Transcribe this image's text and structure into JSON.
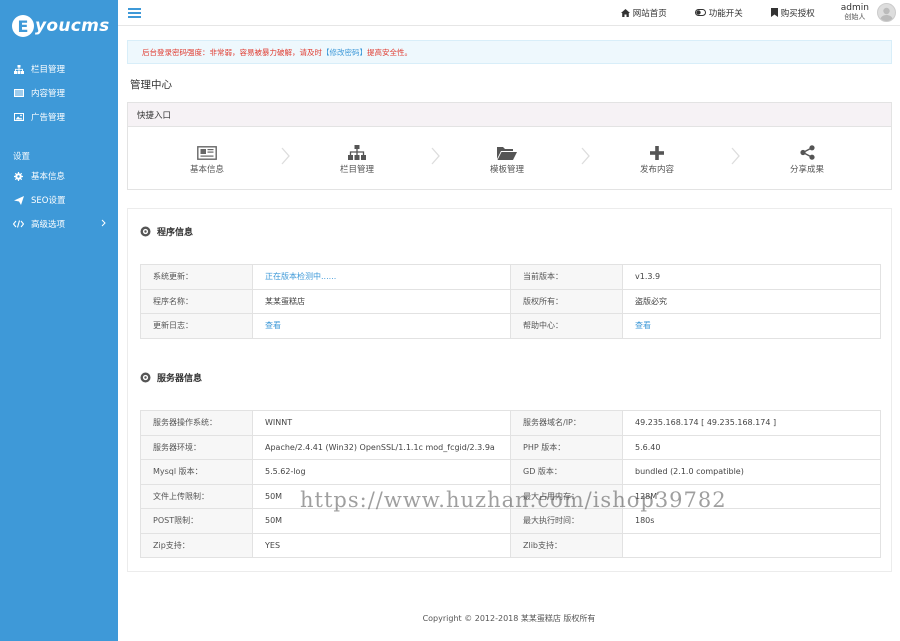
{
  "sidebar": {
    "logo_mark": "E",
    "logo_text": "youcms",
    "items": [
      {
        "label": "栏目管理",
        "icon": "sitemap-icon"
      },
      {
        "label": "内容管理",
        "icon": "list-icon"
      },
      {
        "label": "广告管理",
        "icon": "image-icon"
      }
    ],
    "section_label": "设置",
    "settings": [
      {
        "label": "基本信息",
        "icon": "gear-icon"
      },
      {
        "label": "SEO设置",
        "icon": "paper-plane-icon"
      },
      {
        "label": "高级选项",
        "icon": "code-icon"
      }
    ],
    "colors": {
      "background": "#3e99d8"
    }
  },
  "topbar": {
    "links": [
      {
        "label": "网站首页",
        "icon": "home-icon"
      },
      {
        "label": "功能开关",
        "icon": "toggle-icon"
      },
      {
        "label": "购买授权",
        "icon": "bookmark-icon"
      }
    ],
    "user": {
      "name": "admin",
      "role": "创始人"
    }
  },
  "alert": {
    "text_before": "后台登录密码强度：非常弱，容易被暴力破解，请及时",
    "link": "【修改密码】",
    "text_after": "提高安全性。"
  },
  "page_title": "管理中心",
  "quick": {
    "title": "快捷入口",
    "items": [
      {
        "label": "基本信息",
        "icon": "newspaper-icon"
      },
      {
        "label": "栏目管理",
        "icon": "sitemap-icon"
      },
      {
        "label": "模板管理",
        "icon": "folder-open-icon"
      },
      {
        "label": "发布内容",
        "icon": "plus-icon"
      },
      {
        "label": "分享成果",
        "icon": "share-icon"
      }
    ]
  },
  "program": {
    "title": "程序信息",
    "rows": [
      {
        "k1": "系统更新：",
        "v1": "正在版本检测中......",
        "v1_link": true,
        "k2": "当前版本：",
        "v2": "v1.3.9",
        "v2_link": false
      },
      {
        "k1": "程序名称：",
        "v1": "某某蛋糕店",
        "v1_link": false,
        "k2": "版权所有：",
        "v2": "盗版必究",
        "v2_link": false
      },
      {
        "k1": "更新日志：",
        "v1": "查看",
        "v1_link": true,
        "k2": "帮助中心：",
        "v2": "查看",
        "v2_link": true
      }
    ]
  },
  "server": {
    "title": "服务器信息",
    "rows": [
      {
        "k1": "服务器操作系统：",
        "v1": "WINNT",
        "k2": "服务器域名/IP：",
        "v2": "49.235.168.174 [ 49.235.168.174 ]"
      },
      {
        "k1": "服务器环境：",
        "v1": "Apache/2.4.41 (Win32) OpenSSL/1.1.1c mod_fcgid/2.3.9a",
        "k2": "PHP 版本：",
        "v2": "5.6.40"
      },
      {
        "k1": "Mysql 版本：",
        "v1": "5.5.62-log",
        "k2": "GD 版本：",
        "v2": "bundled (2.1.0 compatible)"
      },
      {
        "k1": "文件上传限制：",
        "v1": "50M",
        "k2": "最大占用内存：",
        "v2": "128M"
      },
      {
        "k1": "POST限制：",
        "v1": "50M",
        "k2": "最大执行时间：",
        "v2": "180s"
      },
      {
        "k1": "Zip支持：",
        "v1": "YES",
        "k2": "Zlib支持：",
        "v2": ""
      }
    ]
  },
  "watermark": "https://www.huzhan.com/ishop39782",
  "footer": "Copyright © 2012-2018 某某蛋糕店 版权所有"
}
